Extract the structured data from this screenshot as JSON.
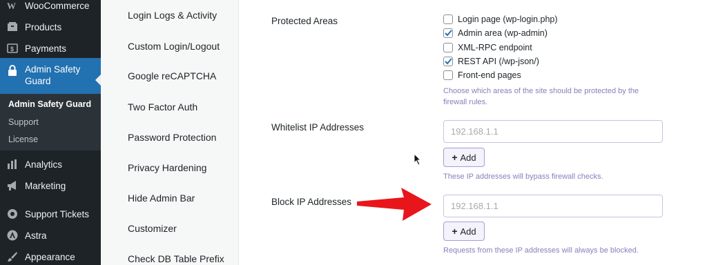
{
  "sidebar": {
    "items": [
      {
        "label": "WooCommerce",
        "icon": "woocommerce-icon"
      },
      {
        "label": "Products",
        "icon": "products-icon"
      },
      {
        "label": "Payments",
        "icon": "payments-icon"
      },
      {
        "label": "Admin Safety Guard",
        "icon": "lock-icon"
      },
      {
        "label": "Analytics",
        "icon": "analytics-icon"
      },
      {
        "label": "Marketing",
        "icon": "megaphone-icon"
      },
      {
        "label": "Support Tickets",
        "icon": "tickets-icon"
      },
      {
        "label": "Astra",
        "icon": "astra-icon"
      },
      {
        "label": "Appearance",
        "icon": "brush-icon"
      }
    ],
    "submenu": [
      "Admin Safety Guard",
      "Support",
      "License"
    ]
  },
  "plugin_nav": [
    "Login Logs & Activity",
    "Custom Login/Logout",
    "Google reCAPTCHA",
    "Two Factor Auth",
    "Password Protection",
    "Privacy Hardening",
    "Hide Admin Bar",
    "Customizer",
    "Check DB Table Prefix"
  ],
  "protected_areas": {
    "label": "Protected Areas",
    "options": [
      {
        "label": "Login page (wp-login.php)",
        "checked": false
      },
      {
        "label": "Admin area (wp-admin)",
        "checked": true
      },
      {
        "label": "XML-RPC endpoint",
        "checked": false
      },
      {
        "label": "REST API (/wp-json/)",
        "checked": true
      },
      {
        "label": "Front-end pages",
        "checked": false
      }
    ],
    "help_line1": "Choose which areas of the site should be protected by the",
    "help_line2": "firewall rules."
  },
  "whitelist": {
    "label": "Whitelist IP Addresses",
    "placeholder": "192.168.1.1",
    "add_label": "Add",
    "help": "These IP addresses will bypass firewall checks."
  },
  "block": {
    "label": "Block IP Addresses",
    "placeholder": "192.168.1.1",
    "add_label": "Add",
    "help": "Requests from these IP addresses will always be blocked."
  },
  "colors": {
    "sidebar_bg": "#1d2327",
    "active_bg": "#2271b1",
    "accent": "#6b4fbb",
    "annotation_arrow": "#e8161b"
  }
}
